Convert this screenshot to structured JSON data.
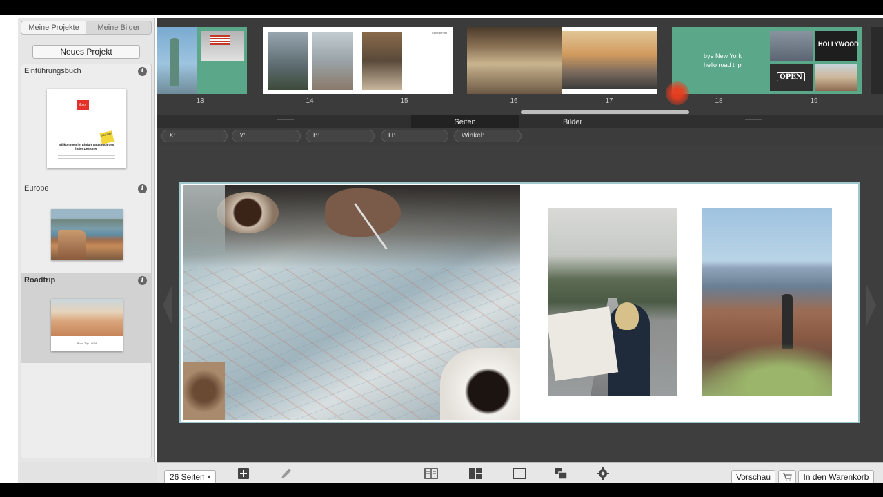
{
  "sidebar": {
    "tabs": [
      "Meine Projekte",
      "Meine Bilder"
    ],
    "new_project_label": "Neues Projekt",
    "projects": [
      {
        "name": "Einführungsbuch",
        "cover_title": "Willkommen im Einführungsbuch des ifolor Designer",
        "cover_sticker": "Bitte hier!",
        "logo_text": "ifolor"
      },
      {
        "name": "Europe"
      },
      {
        "name": "Roadtrip",
        "cover_caption": "Road Trip - USA"
      }
    ],
    "info_icon": "info-icon"
  },
  "strip": {
    "page_numbers": [
      "13",
      "14",
      "15",
      "16",
      "17",
      "18",
      "19"
    ],
    "page18_text": [
      "bye New York",
      "hello road trip"
    ],
    "page15_text": "Central Park",
    "page19_signs": [
      "HOLLYWOOD",
      "OPEN"
    ]
  },
  "view_tabs": [
    "Seiten",
    "Bilder"
  ],
  "properties": [
    {
      "label": "X:"
    },
    {
      "label": "Y:"
    },
    {
      "label": "B:"
    },
    {
      "label": "H:"
    },
    {
      "label": "Winkel:"
    }
  ],
  "toolbar": {
    "page_count": "26 Seiten",
    "icons": [
      "add-page-icon",
      "edit-icon",
      "book-view-icon",
      "layout-icon",
      "single-page-icon",
      "arrange-icon",
      "settings-icon"
    ],
    "preview_label": "Vorschau",
    "cart_icon": "cart-icon",
    "cart_label": "In den Warenkorb"
  },
  "colors": {
    "accent_green": "#5aa889",
    "spread_border": "#9cc8ce",
    "editor_bg": "#3e3e3e"
  }
}
